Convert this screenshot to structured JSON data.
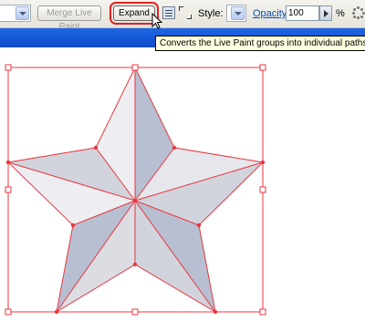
{
  "toolbar": {
    "merge_label": "Merge Live Paint",
    "expand_label": "Expand",
    "style_label": "Style:",
    "opacity_label": "Opacity:",
    "opacity_value": "100",
    "percent_label": "%"
  },
  "tooltip": {
    "text": "Converts the Live Paint groups into individual paths"
  },
  "colors": {
    "selection": "#e8373f",
    "light_fill": "#eeeef2",
    "mid_fill": "#d2d4dd",
    "dark_fill": "#b7bfd1",
    "toolbar_blue": "#1557d6",
    "tooltip_bg": "#ffffe1"
  },
  "icons": [
    "chevron-down-icon",
    "live-paint-options-icon",
    "isolate-group-icon",
    "more-options-icon",
    "pointer-cursor-icon"
  ]
}
